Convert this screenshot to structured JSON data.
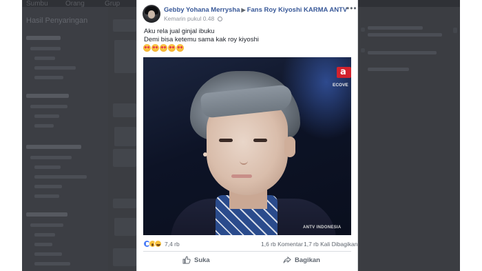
{
  "background": {
    "tabs": [
      "Sumbu",
      "Orang",
      "Grup"
    ],
    "sidebar_title": "Hasil Penyaringan",
    "right_title": "Disarankan untuk Anda"
  },
  "post": {
    "author": "Gebby Yohana Merrysha",
    "group": "Fans Roy Kiyoshi KARMA ANTV",
    "timestamp": "Kemarin pukul 0.48",
    "text_lines": [
      "Aku rela jual ginjal ibuku",
      "Demi bisa ketemu sama kak roy kiyoshi"
    ],
    "emoji_count": 5,
    "emoji_name": "heart-eyes-emoji",
    "photo": {
      "channel_logo": "a",
      "channel_text": "ECOVE",
      "caption": "ANTV INDONESIA"
    },
    "reactions": {
      "types": [
        "like",
        "wow",
        "haha"
      ],
      "count": "7,4 rb"
    },
    "comments": "1,6 rb Komentar",
    "shares": "1,7 rb Kali Dibagikan",
    "actions": {
      "like_label": "Suka",
      "share_label": "Bagikan"
    }
  },
  "colors": {
    "link": "#385898",
    "secondary_text": "#606770",
    "overlay": "#3b3d42"
  }
}
